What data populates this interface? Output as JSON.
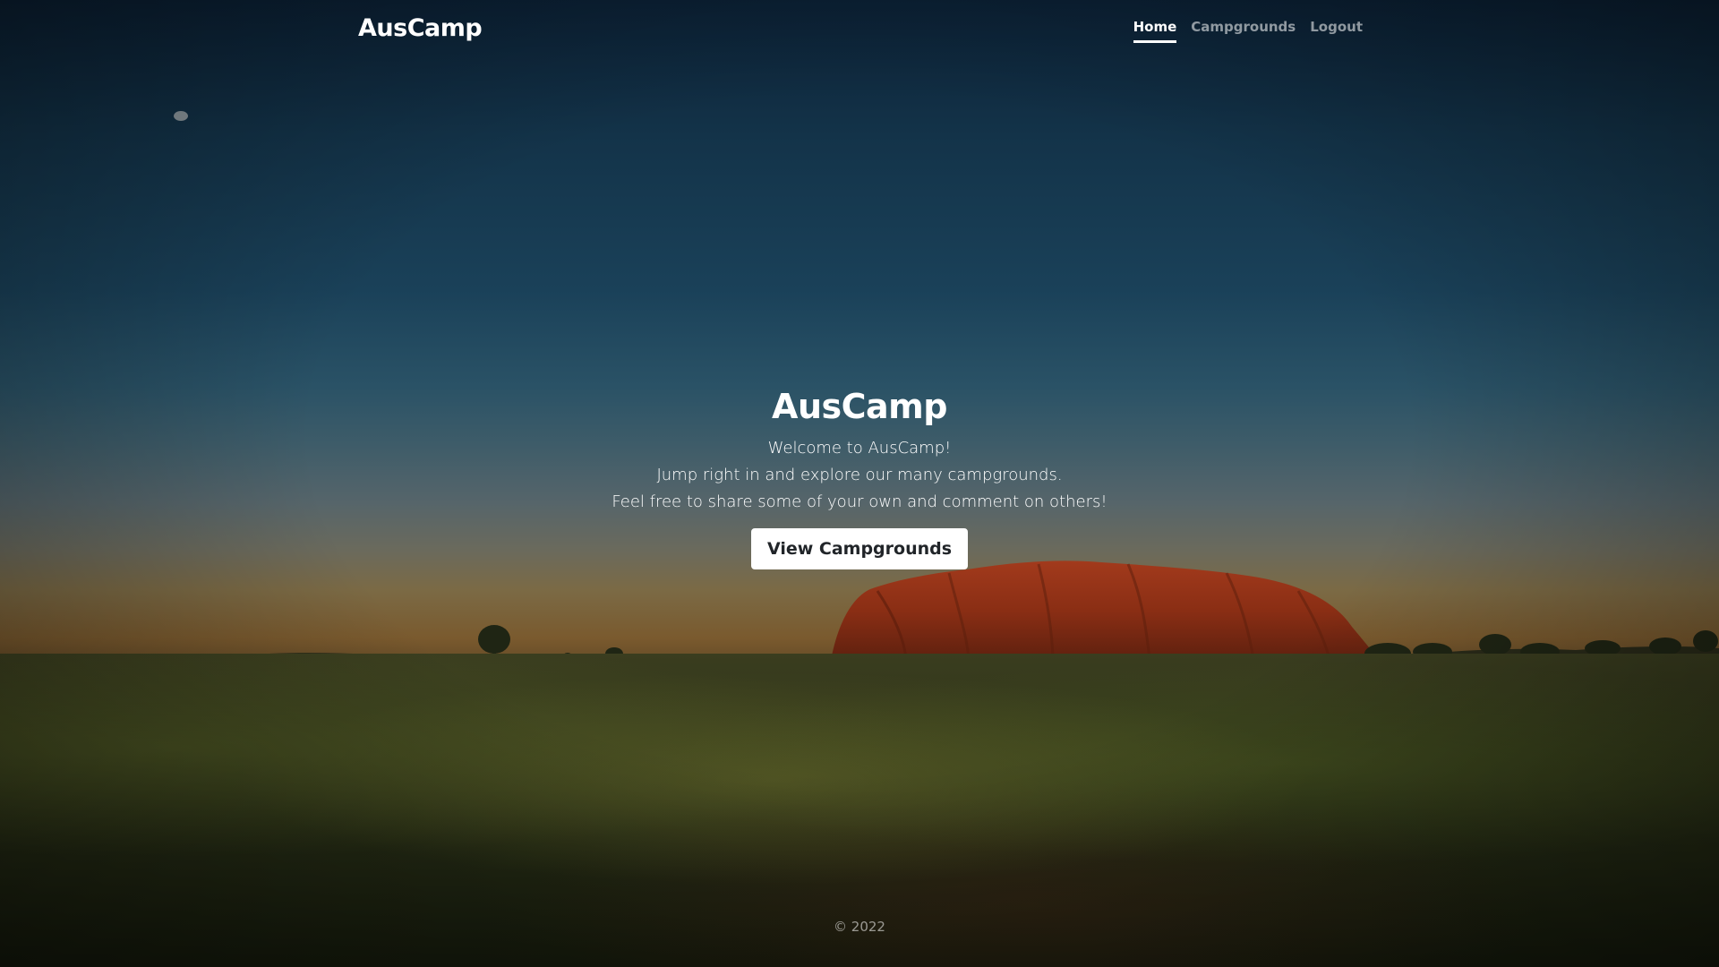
{
  "navbar": {
    "brand": "AusCamp",
    "links": [
      {
        "label": "Home",
        "active": true
      },
      {
        "label": "Campgrounds",
        "active": false
      },
      {
        "label": "Logout",
        "active": false
      }
    ]
  },
  "hero": {
    "title": "AusCamp",
    "lines": [
      "Welcome to AusCamp!",
      "Jump right in and explore our many campgrounds.",
      "Feel free to share some of your own and comment on others!"
    ],
    "button_label": "View Campgrounds"
  },
  "footer": {
    "copyright": "© 2022"
  },
  "colors": {
    "sky_top": "#0b2034",
    "rock": "#8a2e14",
    "button_bg": "#ffffff",
    "button_text": "#212529"
  }
}
